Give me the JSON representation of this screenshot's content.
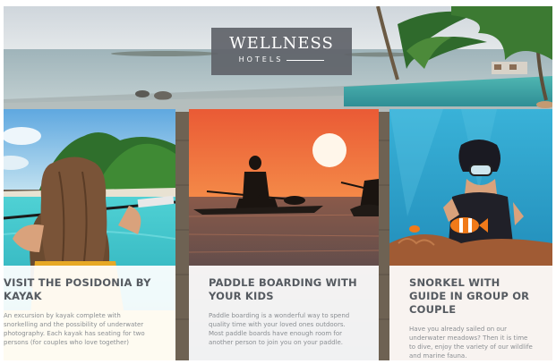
{
  "brand": {
    "name": "WELLNESS",
    "tagline": "HOTELS"
  },
  "cards": [
    {
      "title": "VISIT THE POSIDONIA BY KAYAK",
      "text": "An excursion by kayak complete with snorkelling and the possibility of underwater photography. Each kayak has seating for two persons (for couples who love together)"
    },
    {
      "title": "PADDLE BOARDING WITH YOUR KIDS",
      "text": "Paddle boarding is a wonderful way to spend quality time with your loved ones outdoors. Most paddle boards have enough room for another person to join you on your paddle."
    },
    {
      "title": "SNORKEL WITH GUIDE IN GROUP OR COUPLE",
      "text": "Have you already sailed on our underwater meadows? Then it is time to dive, enjoy the variety of our wildlife and marine fauna."
    }
  ],
  "colors": {
    "logo_bg": "#5f6369",
    "card_title": "#555a60",
    "card_text": "#8a8e92",
    "sunset": "#f06a3a",
    "sea": "#2aa3c8"
  }
}
